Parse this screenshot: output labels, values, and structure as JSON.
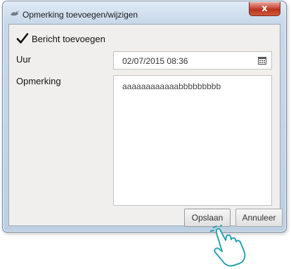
{
  "window": {
    "title": "Opmerking toevoegen/wijzigen",
    "close_label": "x"
  },
  "form": {
    "checkbox_label": "Bericht toevoegen",
    "checkbox_checked": true,
    "uur_label": "Uur",
    "uur_value": "02/07/2015 08:36",
    "opmerking_label": "Opmerking",
    "opmerking_value": "aaaaaaaaaaaabbbbbbbbb"
  },
  "buttons": {
    "save_label": "Opslaan",
    "cancel_label": "Annuleer"
  },
  "icons": {
    "app": "bird-icon",
    "calendar": "calendar-icon",
    "pointer": "hand-pointer-icon"
  },
  "colors": {
    "title_bar": "#c9d9ea",
    "close_button": "#c9493a",
    "client_area": "#f0efee"
  }
}
